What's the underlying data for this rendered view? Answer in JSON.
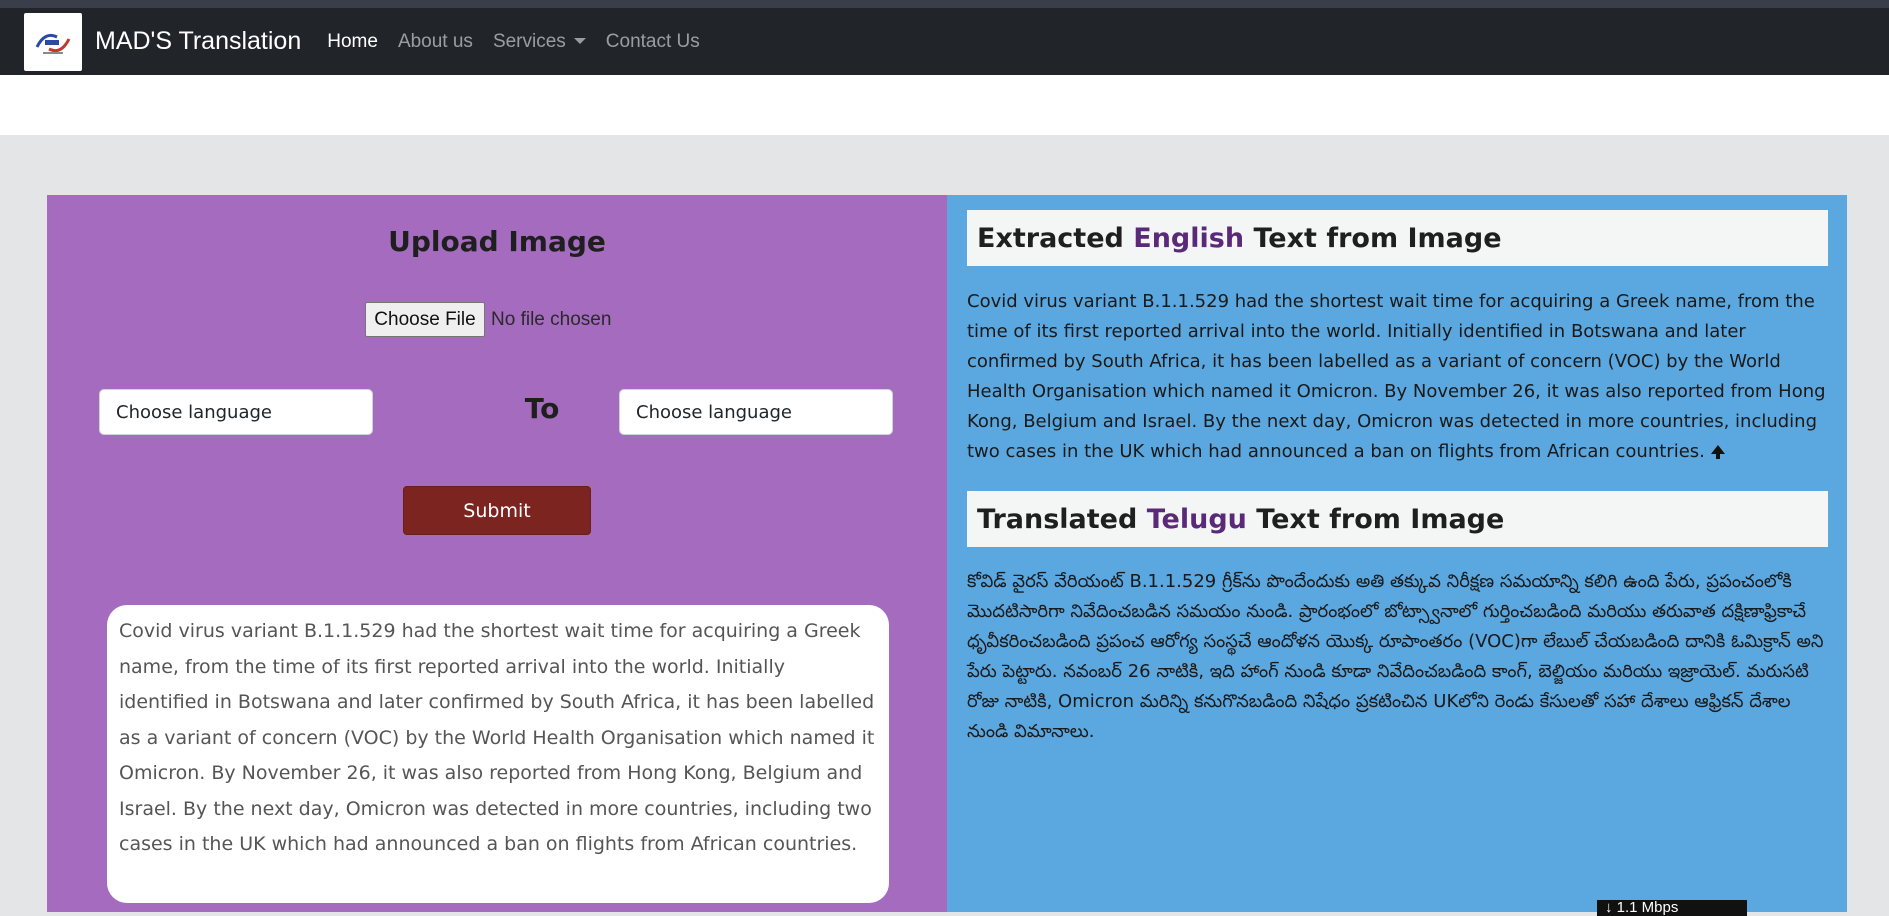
{
  "navbar": {
    "brand": "MAD'S Translation",
    "links": [
      {
        "label": "Home",
        "active": true
      },
      {
        "label": "About us"
      },
      {
        "label": "Services"
      },
      {
        "label": "Contact Us"
      }
    ],
    "background": "#212529"
  },
  "upload": {
    "title": "Upload Image",
    "file_button": "Choose File",
    "file_status": "No file chosen",
    "source_language": "Choose language",
    "to_label": "To",
    "target_language": "Choose language",
    "submit_label": "Submit",
    "extracted_preview": "Covid virus variant B.1.1.529 had the shortest wait time for acquiring a Greek name, from the time of its first reported arrival into the world. Initially identified in Botswana and later confirmed by South Africa, it has been labelled as a variant of concern (VOC) by the World Health Organisation which named it Omicron. By November 26, it was also reported from Hong Kong, Belgium and Israel.  By the next day, Omicron was detected in more countries, including two cases in the UK which had announced a ban on flights from African countries.",
    "panel_color": "#a46bbf"
  },
  "results": {
    "extracted": {
      "prefix": "Extracted ",
      "language": "English",
      "suffix": " Text from Image",
      "text": "Covid virus variant B.1.1.529 had the shortest wait time for acquiring a Greek name, from the time of its first reported arrival into the world. Initially identified in Botswana and later confirmed by South Africa, it has been labelled as a variant of concern (VOC) by the World Health Organisation which named it Omicron. By November 26, it was also reported from Hong Kong, Belgium and Israel. By the next day, Omicron was detected in more countries, including two cases in the UK which had announced a ban on flights from African countries."
    },
    "translated": {
      "prefix": "Translated ",
      "language": "Telugu",
      "suffix": " Text from Image",
      "text": "కోవిడ్ వైరస్ వేరియంట్ B.1.1.529 గ్రీక్‌ను పొందేందుకు అతి తక్కువ నిరీక్షణ సమయాన్ని కలిగి ఉంది పేరు, ప్రపంచంలోకి మొదటిసారిగా నివేదించబడిన సమయం నుండి. ప్రారంభంలో బోట్స్వానాలో గుర్తించబడింది మరియు తరువాత దక్షిణాఫ్రికాచే ధృవీకరించబడింది ప్రపంచ ఆరోగ్య సంస్థచే ఆందోళన యొక్క రూపాంతరం (VOC)గా లేబుల్ చేయబడింది దానికి ఓమిక్రాన్ అని పేరు పెట్టారు. నవంబర్ 26 నాటికి, ఇది హాంగ్ నుండి కూడా నివేదించబడింది కాంగ్, బెల్జియం మరియు ఇజ్రాయెల్. మరుసటి రోజు నాటికి, Omicron మరిన్ని కనుగొనబడింది నిషేధం ప్రకటించిన UKలోని రెండు కేసులతో సహా దేశాలు ఆఫ్రికన్ దేశాల నుండి విమానాలు."
    },
    "panel_color": "#5ba7df",
    "speed_badge": "↓ 1.1 Mbps"
  }
}
